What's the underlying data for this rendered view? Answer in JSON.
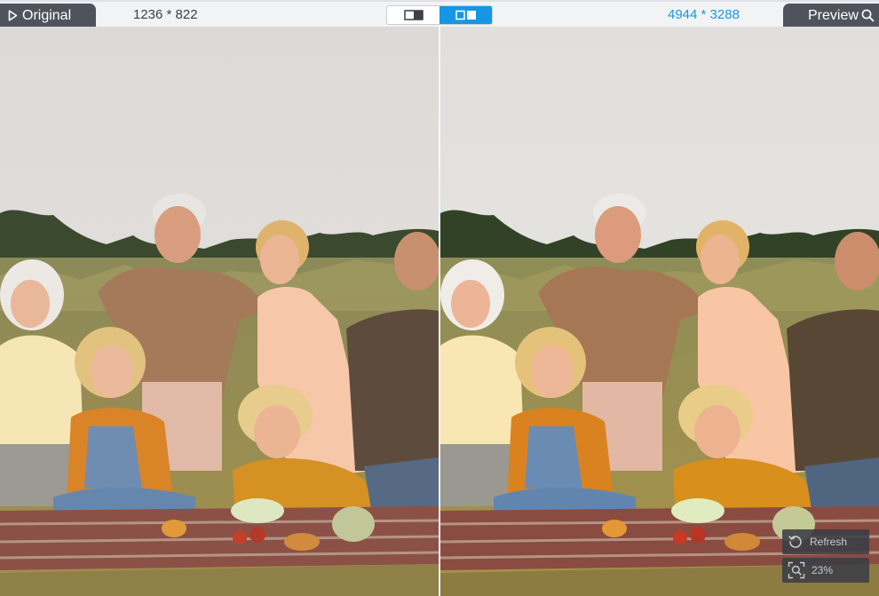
{
  "left": {
    "label": "Original",
    "resolution": "1236 * 822"
  },
  "right": {
    "label": "Preview",
    "resolution": "4944 * 3288"
  },
  "view_toggle": {
    "options": [
      "split-half-view",
      "side-by-side-view"
    ],
    "active": "side-by-side-view"
  },
  "controls": {
    "refresh_label": "Refresh",
    "zoom_label": "23%"
  },
  "icons": {
    "play": "play-triangle-icon",
    "search": "magnifier-icon",
    "refresh": "refresh-icon",
    "zoom": "zoom-fit-icon"
  },
  "colors": {
    "accent": "#1597e5",
    "tag_bg": "#4f535c",
    "bar_bg": "#f2f3f5"
  }
}
